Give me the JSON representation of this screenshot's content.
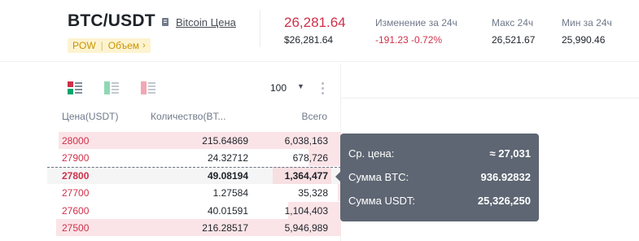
{
  "header": {
    "pair": "BTC/USDT",
    "coin_link": "Bitcoin Цена",
    "tags": [
      "POW",
      "Объем"
    ],
    "last_price": "26,281.64",
    "last_price_usd": "$26,281.64",
    "stats": [
      {
        "label": "Изменение за 24ч",
        "value": "-191.23 -0.72%",
        "negative": true
      },
      {
        "label": "Макс 24ч",
        "value": "26,521.67",
        "negative": false
      },
      {
        "label": "Мин за 24ч",
        "value": "25,990.46",
        "negative": false
      }
    ]
  },
  "orderbook": {
    "depth": "100",
    "layout_modes": [
      "both",
      "bids",
      "asks"
    ],
    "columns": {
      "price": "Цена(USDT)",
      "qty": "Количество(BT...",
      "total": "Всего"
    },
    "rows": [
      {
        "price": "28000",
        "qty": "215.64869",
        "total": "6,038,163",
        "fill": 0.96,
        "selected": false
      },
      {
        "price": "27900",
        "qty": "24.32712",
        "total": "678,726",
        "fill": 0.11,
        "selected": false
      },
      {
        "price": "27800",
        "qty": "49.08194",
        "total": "1,364,477",
        "fill": 0.0,
        "selected": true
      },
      {
        "price": "27700",
        "qty": "1.27584",
        "total": "35,328",
        "fill": 0.01,
        "selected": false
      },
      {
        "price": "27600",
        "qty": "40.01591",
        "total": "1,104,403",
        "fill": 0.18,
        "selected": false
      },
      {
        "price": "27500",
        "qty": "216.28517",
        "total": "5,946,989",
        "fill": 0.97,
        "selected": false
      }
    ]
  },
  "tooltip": {
    "items": [
      {
        "label": "Ср. цена:",
        "value": "≈ 27,031"
      },
      {
        "label": "Сумма BTC:",
        "value": "936.92832"
      },
      {
        "label": "Сумма USDT:",
        "value": "25,326,250"
      }
    ]
  },
  "colors": {
    "ask": "#cf304a",
    "bid": "#03a66d",
    "accent": "#f0b90b",
    "tooltip_bg": "#5e6673"
  }
}
